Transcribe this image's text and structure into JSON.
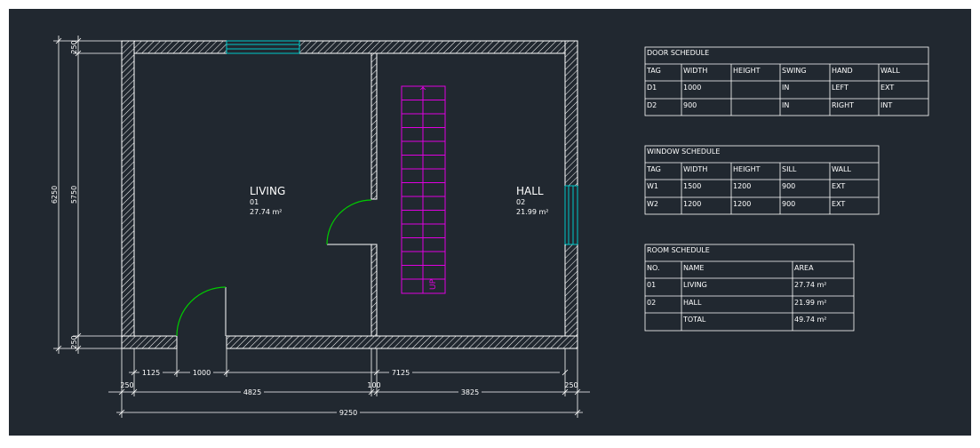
{
  "colors": {
    "page_bg": "#ffffff",
    "canvas_bg": "#212830",
    "line": "#ffffff",
    "door_arc": "#00cc00",
    "window": "#00c8c8",
    "stair": "#e000e0"
  },
  "rooms": [
    {
      "name": "LIVING",
      "number": "01",
      "area": "27.74 m²"
    },
    {
      "name": "HALL",
      "number": "02",
      "area": "21.99 m²"
    }
  ],
  "stair": {
    "label": "UP",
    "arrow": "^"
  },
  "dimensions": {
    "left_outer": "6250",
    "left_top": "250",
    "left_mid": "5750",
    "left_bottom": "250",
    "bottom_d1": "1125",
    "bottom_d2": "1000",
    "bottom_d3": "7125",
    "bottom_wall_left": "250",
    "bottom_mid_left": "4825",
    "bottom_wall_mid": "100",
    "bottom_mid_right": "3825",
    "bottom_wall_right": "250",
    "bottom_total": "9250"
  },
  "door_schedule": {
    "title": "DOOR SCHEDULE",
    "headers": [
      "TAG",
      "WIDTH",
      "HEIGHT",
      "SWING",
      "HAND",
      "WALL"
    ],
    "rows": [
      [
        "D1",
        "1000",
        "",
        "IN",
        "LEFT",
        "EXT"
      ],
      [
        "D2",
        "900",
        "",
        "IN",
        "RIGHT",
        "INT"
      ]
    ]
  },
  "window_schedule": {
    "title": "WINDOW SCHEDULE",
    "headers": [
      "TAG",
      "WIDTH",
      "HEIGHT",
      "SILL",
      "WALL"
    ],
    "rows": [
      [
        "W1",
        "1500",
        "1200",
        "900",
        "EXT"
      ],
      [
        "W2",
        "1200",
        "1200",
        "900",
        "EXT"
      ]
    ]
  },
  "room_schedule": {
    "title": "ROOM SCHEDULE",
    "headers": [
      "NO.",
      "NAME",
      "AREA"
    ],
    "rows": [
      [
        "01",
        "LIVING",
        "27.74 m²"
      ],
      [
        "02",
        "HALL",
        "21.99 m²"
      ],
      [
        "",
        "TOTAL",
        "49.74 m²"
      ]
    ]
  }
}
